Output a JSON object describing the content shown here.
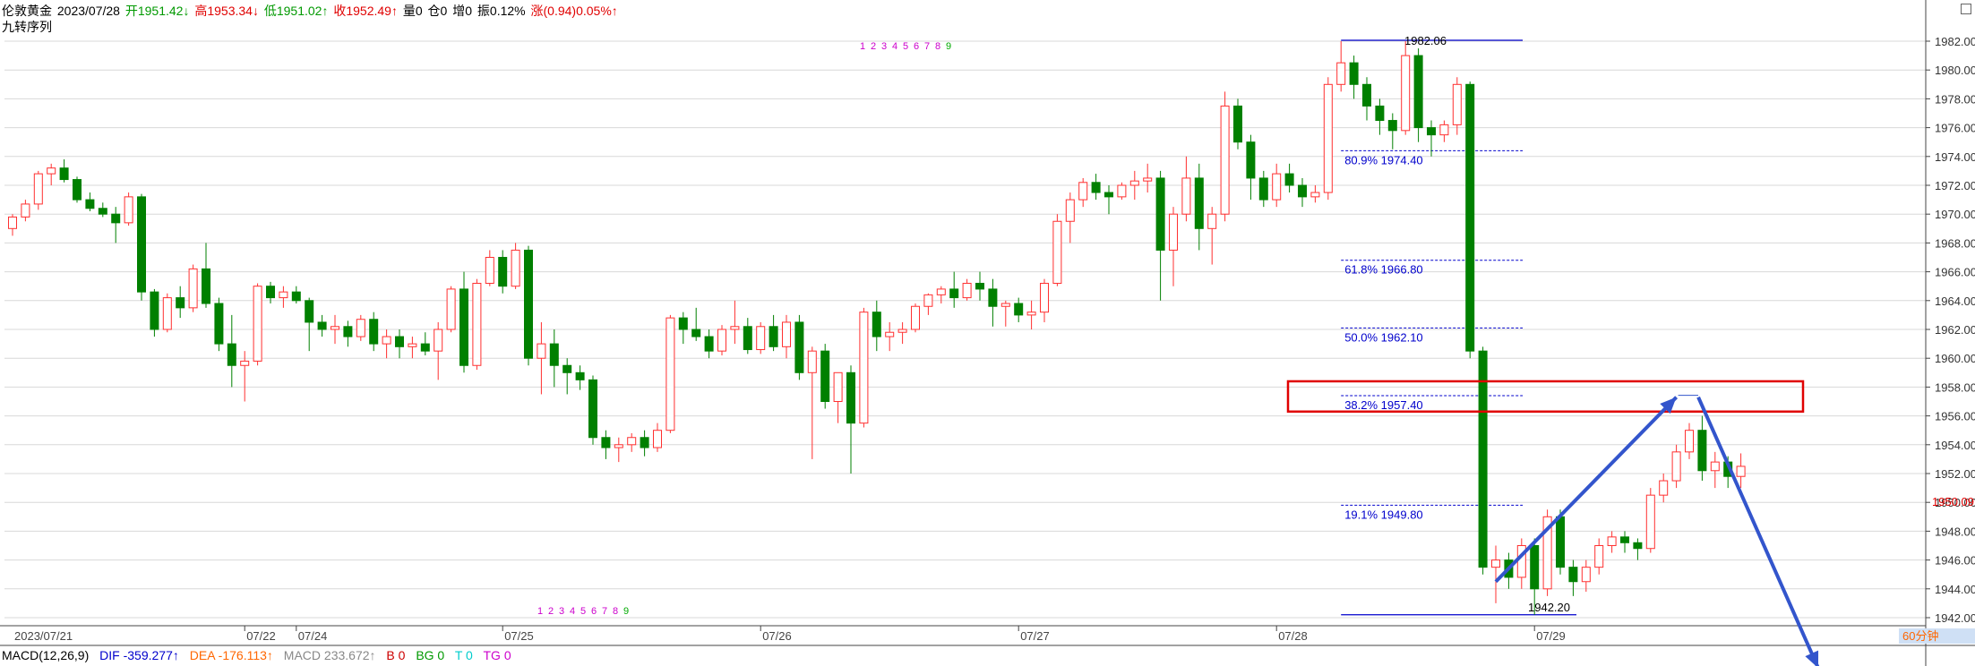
{
  "header": {
    "title": "伦敦黄金",
    "date": "2023/07/28",
    "open": "开1951.42↓",
    "high": "高1953.34↓",
    "low": "低1951.02↑",
    "close": "收1952.49↑",
    "volume": "量0",
    "position": "仓0",
    "increase": "增0",
    "amplitude": "振0.12%",
    "change": "涨(0.94)0.05%↑"
  },
  "indicator_label": "九转序列",
  "macd": {
    "label": "MACD(12,26,9)",
    "dif": "DIF -359.277↑",
    "dea": "DEA -176.113↑",
    "macd": "MACD 233.672↑",
    "b": "B 0",
    "bg": "BG 0",
    "t": "T 0",
    "tg": "TG 0"
  },
  "period": "60分钟",
  "colors": {
    "up": "#ff3030",
    "down": "#008000",
    "fib": "#0000cc",
    "box": "#e00000",
    "arrow": "#3355cc"
  },
  "chart_data": {
    "type": "candlestick",
    "y_axis": {
      "min": 1942,
      "max": 1982,
      "step": 2,
      "ticks": [
        "1982.00",
        "1980.00",
        "1978.00",
        "1976.00",
        "1974.00",
        "1972.00",
        "1970.00",
        "1968.00",
        "1966.00",
        "1964.00",
        "1962.00",
        "1960.00",
        "1958.00",
        "1956.00",
        "1954.00",
        "1952.00",
        "1950.00",
        "1948.00",
        "1946.00",
        "1944.00",
        "1942.00"
      ]
    },
    "current_price": "1950.09",
    "x_labels": [
      {
        "i": 0,
        "text": "2023/07/21"
      },
      {
        "i": 18,
        "text": "07/22"
      },
      {
        "i": 22,
        "text": "07/24"
      },
      {
        "i": 38,
        "text": "07/25"
      },
      {
        "i": 58,
        "text": "07/26"
      },
      {
        "i": 78,
        "text": "07/27"
      },
      {
        "i": 98,
        "text": "07/28"
      },
      {
        "i": 118,
        "text": "07/29"
      }
    ],
    "candles": [
      [
        1969.0,
        1970.0,
        1968.5,
        1969.8
      ],
      [
        1969.8,
        1971.0,
        1969.5,
        1970.7
      ],
      [
        1970.7,
        1973.0,
        1970.3,
        1972.8
      ],
      [
        1972.8,
        1973.5,
        1972.0,
        1973.2
      ],
      [
        1973.2,
        1973.8,
        1972.2,
        1972.4
      ],
      [
        1972.4,
        1972.6,
        1970.8,
        1971.0
      ],
      [
        1971.0,
        1971.5,
        1970.2,
        1970.4
      ],
      [
        1970.4,
        1970.8,
        1969.8,
        1970.0
      ],
      [
        1970.0,
        1970.5,
        1968.0,
        1969.4
      ],
      [
        1969.4,
        1971.5,
        1969.2,
        1971.2
      ],
      [
        1971.2,
        1971.4,
        1964.0,
        1964.6
      ],
      [
        1964.6,
        1964.8,
        1961.5,
        1962.0
      ],
      [
        1962.0,
        1964.5,
        1961.8,
        1964.2
      ],
      [
        1964.2,
        1965.0,
        1962.8,
        1963.5
      ],
      [
        1963.5,
        1966.5,
        1963.2,
        1966.2
      ],
      [
        1966.2,
        1968.0,
        1963.5,
        1963.8
      ],
      [
        1963.8,
        1964.2,
        1960.5,
        1961.0
      ],
      [
        1961.0,
        1963.0,
        1958.0,
        1959.5
      ],
      [
        1959.5,
        1960.5,
        1957.0,
        1959.8
      ],
      [
        1959.8,
        1965.2,
        1959.5,
        1965.0
      ],
      [
        1965.0,
        1965.3,
        1963.8,
        1964.2
      ],
      [
        1964.2,
        1965.0,
        1963.5,
        1964.6
      ],
      [
        1964.6,
        1965.0,
        1963.8,
        1964.0
      ],
      [
        1964.0,
        1964.2,
        1960.5,
        1962.5
      ],
      [
        1962.5,
        1963.0,
        1961.5,
        1962.0
      ],
      [
        1962.0,
        1963.0,
        1961.0,
        1962.2
      ],
      [
        1962.2,
        1962.6,
        1960.8,
        1961.5
      ],
      [
        1961.5,
        1963.0,
        1961.2,
        1962.7
      ],
      [
        1962.7,
        1963.2,
        1960.5,
        1961.0
      ],
      [
        1961.0,
        1962.0,
        1960.0,
        1961.5
      ],
      [
        1961.5,
        1962.0,
        1960.0,
        1960.8
      ],
      [
        1960.8,
        1961.5,
        1960.0,
        1961.0
      ],
      [
        1961.0,
        1961.8,
        1960.2,
        1960.5
      ],
      [
        1960.5,
        1962.5,
        1958.5,
        1962.0
      ],
      [
        1962.0,
        1965.0,
        1961.8,
        1964.8
      ],
      [
        1964.8,
        1966.0,
        1959.0,
        1959.5
      ],
      [
        1959.5,
        1965.5,
        1959.2,
        1965.2
      ],
      [
        1965.2,
        1967.5,
        1965.0,
        1967.0
      ],
      [
        1967.0,
        1967.5,
        1964.5,
        1965.0
      ],
      [
        1965.0,
        1968.0,
        1964.8,
        1967.5
      ],
      [
        1967.5,
        1967.8,
        1959.5,
        1960.0
      ],
      [
        1960.0,
        1962.5,
        1957.5,
        1961.0
      ],
      [
        1961.0,
        1962.0,
        1958.0,
        1959.5
      ],
      [
        1959.5,
        1960.0,
        1957.5,
        1959.0
      ],
      [
        1959.0,
        1959.5,
        1957.8,
        1958.5
      ],
      [
        1958.5,
        1958.8,
        1954.0,
        1954.5
      ],
      [
        1954.5,
        1955.0,
        1953.0,
        1953.8
      ],
      [
        1953.8,
        1954.5,
        1952.8,
        1954.0
      ],
      [
        1954.0,
        1954.8,
        1953.5,
        1954.5
      ],
      [
        1954.5,
        1955.0,
        1953.2,
        1953.8
      ],
      [
        1953.8,
        1955.5,
        1953.5,
        1955.0
      ],
      [
        1955.0,
        1963.0,
        1954.8,
        1962.8
      ],
      [
        1962.8,
        1963.2,
        1961.0,
        1962.0
      ],
      [
        1962.0,
        1963.5,
        1961.2,
        1961.5
      ],
      [
        1961.5,
        1962.0,
        1960.0,
        1960.5
      ],
      [
        1960.5,
        1962.3,
        1960.2,
        1962.0
      ],
      [
        1962.0,
        1964.0,
        1961.0,
        1962.2
      ],
      [
        1962.2,
        1962.8,
        1960.3,
        1960.6
      ],
      [
        1960.6,
        1962.5,
        1960.3,
        1962.2
      ],
      [
        1962.2,
        1963.0,
        1960.5,
        1960.8
      ],
      [
        1960.8,
        1963.0,
        1960.0,
        1962.5
      ],
      [
        1962.5,
        1963.0,
        1958.5,
        1959.0
      ],
      [
        1959.0,
        1960.8,
        1953.0,
        1960.5
      ],
      [
        1960.5,
        1961.0,
        1956.5,
        1957.0
      ],
      [
        1957.0,
        1959.0,
        1955.5,
        1959.0
      ],
      [
        1959.0,
        1959.5,
        1952.0,
        1955.5
      ],
      [
        1955.5,
        1963.5,
        1955.2,
        1963.2
      ],
      [
        1963.2,
        1964.0,
        1960.5,
        1961.5
      ],
      [
        1961.5,
        1962.5,
        1960.5,
        1961.8
      ],
      [
        1961.8,
        1962.5,
        1961.0,
        1962.0
      ],
      [
        1962.0,
        1963.8,
        1961.8,
        1963.6
      ],
      [
        1963.6,
        1964.5,
        1963.0,
        1964.4
      ],
      [
        1964.4,
        1965.0,
        1963.8,
        1964.8
      ],
      [
        1964.8,
        1966.0,
        1963.5,
        1964.2
      ],
      [
        1964.2,
        1965.5,
        1964.0,
        1965.2
      ],
      [
        1965.2,
        1966.0,
        1964.0,
        1964.8
      ],
      [
        1964.8,
        1965.5,
        1962.2,
        1963.6
      ],
      [
        1963.6,
        1964.0,
        1962.2,
        1963.8
      ],
      [
        1963.8,
        1964.2,
        1962.5,
        1963.0
      ],
      [
        1963.0,
        1964.0,
        1962.0,
        1963.2
      ],
      [
        1963.2,
        1965.5,
        1962.5,
        1965.2
      ],
      [
        1965.2,
        1970.0,
        1965.0,
        1969.5
      ],
      [
        1969.5,
        1971.5,
        1968.0,
        1971.0
      ],
      [
        1971.0,
        1972.5,
        1970.5,
        1972.2
      ],
      [
        1972.2,
        1972.8,
        1971.0,
        1971.5
      ],
      [
        1971.5,
        1972.0,
        1970.0,
        1971.2
      ],
      [
        1971.2,
        1972.2,
        1971.0,
        1972.0
      ],
      [
        1972.0,
        1973.0,
        1971.0,
        1972.3
      ],
      [
        1972.3,
        1973.5,
        1971.5,
        1972.5
      ],
      [
        1972.5,
        1973.0,
        1964.0,
        1967.5
      ],
      [
        1967.5,
        1970.5,
        1965.0,
        1970.0
      ],
      [
        1970.0,
        1974.0,
        1969.5,
        1972.5
      ],
      [
        1972.5,
        1973.5,
        1967.5,
        1969.0
      ],
      [
        1969.0,
        1970.5,
        1966.5,
        1970.0
      ],
      [
        1970.0,
        1978.5,
        1969.5,
        1977.5
      ],
      [
        1977.5,
        1978.0,
        1974.5,
        1975.0
      ],
      [
        1975.0,
        1975.5,
        1971.0,
        1972.5
      ],
      [
        1972.5,
        1973.0,
        1970.5,
        1971.0
      ],
      [
        1971.0,
        1973.5,
        1970.5,
        1972.8
      ],
      [
        1972.8,
        1973.5,
        1971.5,
        1972.0
      ],
      [
        1972.0,
        1972.5,
        1970.5,
        1971.2
      ],
      [
        1971.2,
        1972.0,
        1970.8,
        1971.5
      ],
      [
        1971.5,
        1979.5,
        1971.0,
        1979.0
      ],
      [
        1979.0,
        1982.0,
        1978.5,
        1980.5
      ],
      [
        1980.5,
        1981.0,
        1978.0,
        1979.0
      ],
      [
        1979.0,
        1979.5,
        1976.5,
        1977.5
      ],
      [
        1977.5,
        1978.0,
        1975.5,
        1976.5
      ],
      [
        1976.5,
        1977.0,
        1974.5,
        1975.8
      ],
      [
        1975.8,
        1982.0,
        1975.5,
        1981.0
      ],
      [
        1981.0,
        1981.5,
        1975.0,
        1976.0
      ],
      [
        1976.0,
        1976.5,
        1974.0,
        1975.5
      ],
      [
        1975.5,
        1976.5,
        1975.0,
        1976.2
      ],
      [
        1976.2,
        1979.5,
        1975.5,
        1979.0
      ],
      [
        1979.0,
        1979.2,
        1960.0,
        1960.5
      ],
      [
        1960.5,
        1960.8,
        1945.0,
        1945.5
      ],
      [
        1945.5,
        1947.0,
        1943.0,
        1946.0
      ],
      [
        1946.0,
        1946.5,
        1944.0,
        1944.8
      ],
      [
        1944.8,
        1947.5,
        1944.0,
        1947.0
      ],
      [
        1947.0,
        1947.5,
        1942.2,
        1944.0
      ],
      [
        1944.0,
        1949.5,
        1943.5,
        1949.0
      ],
      [
        1949.0,
        1949.5,
        1945.0,
        1945.5
      ],
      [
        1945.5,
        1946.0,
        1943.5,
        1944.5
      ],
      [
        1944.5,
        1946.0,
        1943.8,
        1945.5
      ],
      [
        1945.5,
        1947.5,
        1945.0,
        1947.0
      ],
      [
        1947.0,
        1948.0,
        1946.5,
        1947.6
      ],
      [
        1947.6,
        1948.0,
        1946.5,
        1947.2
      ],
      [
        1947.2,
        1947.5,
        1946.0,
        1946.8
      ],
      [
        1946.8,
        1951.0,
        1946.5,
        1950.5
      ],
      [
        1950.5,
        1952.0,
        1950.0,
        1951.5
      ],
      [
        1951.5,
        1954.0,
        1951.0,
        1953.5
      ],
      [
        1953.5,
        1955.5,
        1953.0,
        1955.0
      ],
      [
        1955.0,
        1956.0,
        1951.5,
        1952.2
      ],
      [
        1952.2,
        1953.5,
        1951.0,
        1952.8
      ],
      [
        1952.8,
        1953.2,
        1951.0,
        1951.8
      ],
      [
        1951.8,
        1953.4,
        1951.0,
        1952.5
      ]
    ],
    "fibonacci": [
      {
        "label": "80.9% 1974.40",
        "price": 1974.4
      },
      {
        "label": "61.8% 1966.80",
        "price": 1966.8
      },
      {
        "label": "50.0% 1962.10",
        "price": 1962.1
      },
      {
        "label": "38.2% 1957.40",
        "price": 1957.4
      },
      {
        "label": "19.1% 1949.80",
        "price": 1949.8
      }
    ],
    "fib_high": {
      "label": "1982.06",
      "price": 1982.06
    },
    "fib_low": {
      "label": "1942.20",
      "price": 1942.2
    },
    "td_sequence": [
      {
        "labels": [
          "1",
          "2",
          "3",
          "4",
          "5",
          "6",
          "7",
          "8",
          "9"
        ],
        "start": 67,
        "row": "top"
      },
      {
        "labels": [
          "1",
          "2",
          "3",
          "4",
          "5",
          "6",
          "7",
          "8",
          "9"
        ],
        "start": 30,
        "row": "bottom"
      }
    ],
    "zone": {
      "price_top": 1958.4,
      "price_bottom": 1956.3
    },
    "arrow_up": {
      "from": [
        115,
        1944.5
      ],
      "to": [
        129,
        1957.3
      ]
    },
    "arrow_down": {
      "from": [
        130,
        1957.3
      ],
      "to": [
        140,
        1938.5
      ]
    }
  }
}
